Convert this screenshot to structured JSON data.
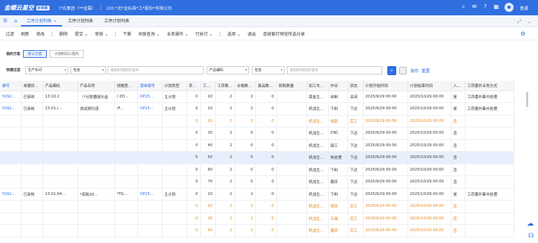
{
  "app": {
    "logo_text": "金蝶云星空",
    "badge": "标准版",
    "org": "（*氏集团（**金属）",
    "company": "100 *北*金标准*工*股份*有限公司",
    "user": "普通"
  },
  "tabs": [
    {
      "label": "工序计划列表",
      "active": true
    },
    {
      "label": "工序计划列表",
      "active": false
    },
    {
      "label": "工序计划列表",
      "active": false
    }
  ],
  "toolbar": [
    "过滤",
    "刷新",
    "修改",
    "删除",
    "提交",
    "审核",
    "下推",
    "关联查询",
    "业务操作",
    "行执行",
    "选项",
    "退出",
    "连续套打预览所选分录"
  ],
  "scheme": {
    "label": "我的方案",
    "buttons": [
      "默认方案",
      "计划时间三周内"
    ]
  },
  "filter": {
    "label": "快捷过滤",
    "field1": "生产车间",
    "op1": "包含",
    "placeholder1": "请选择内容回车查询",
    "field2": "产品编码",
    "op2": "包含",
    "placeholder2": "请选择内容回车查询",
    "save": "保存",
    "reset": "重置"
  },
  "columns": [
    "编号",
    "单据状...",
    "产品编码",
    "产品名称",
    "规格型...",
    "源单编号",
    "计划类型",
    "序...",
    "工...",
    "工序数...",
    "合格数...",
    "废品数...",
    "损耗数量",
    "加工车...",
    "作业",
    "状态",
    "计划开始时间",
    "计划结束时间",
    "入...",
    "工序委外业务方式"
  ],
  "rows": [
    {
      "style": "",
      "cells": [
        "5092...",
        "已审核",
        "13.10.2",
        "（*分割器接头盒",
        "/ ZD...",
        "OP25...",
        "主计划",
        "0",
        "10",
        "2",
        "2",
        "0",
        "",
        "钣金生...",
        "自制",
        "关闭",
        "2025/9/29 00:00",
        "2025/10/29 00:00",
        "是",
        "工序委外集中处理"
      ]
    },
    {
      "style": "",
      "cells": [
        "5092...",
        "已审核",
        "13.01.(...",
        "测试焊针座",
        "/F...",
        "OP25...",
        "主计划",
        "0",
        "10",
        "2",
        "2",
        "0",
        "",
        "机加生...",
        "下料",
        "下达",
        "2025/9/29 00:00",
        "2025/10/29 00:00",
        "是",
        "工序委外集中处理"
      ]
    },
    {
      "style": "orange",
      "cells": [
        "",
        "",
        "",
        "",
        "",
        "",
        "",
        "0",
        "20",
        "2",
        "0",
        "0",
        "",
        "机加生...",
        "线割",
        "完工",
        "2025/9/29 00:00",
        "2025/10/29 00:00",
        "否",
        ""
      ]
    },
    {
      "style": "",
      "cells": [
        "",
        "",
        "",
        "",
        "",
        "",
        "",
        "0",
        "30",
        "2",
        "0",
        "0",
        "",
        "机加生...",
        "CNC",
        "下达",
        "2025/9/29 00:00",
        "2025/10/29 00:00",
        "否",
        ""
      ]
    },
    {
      "style": "",
      "cells": [
        "",
        "",
        "",
        "",
        "",
        "",
        "",
        "0",
        "40",
        "2",
        "0",
        "0",
        "",
        "机加生...",
        "钳工",
        "下达",
        "2025/9/29 00:00",
        "2025/10/29 00:00",
        "否",
        ""
      ]
    },
    {
      "style": "sel",
      "cells": [
        "",
        "",
        "",
        "",
        "",
        "",
        "",
        "0",
        "50",
        "2",
        "0",
        "0",
        "",
        "机加生...",
        "热处理",
        "下达",
        "2025/9/29 00:00",
        "2025/10/29 00:00",
        "否",
        ""
      ]
    },
    {
      "style": "",
      "cells": [
        "",
        "",
        "",
        "",
        "",
        "",
        "",
        "0",
        "60",
        "2",
        "0",
        "0",
        "",
        "机加生...",
        "下料",
        "下达",
        "2025/9/29 00:00",
        "2025/10/29 00:00",
        "否",
        ""
      ]
    },
    {
      "style": "",
      "cells": [
        "",
        "",
        "",
        "",
        "",
        "",
        "",
        "0",
        "70",
        "2",
        "0",
        "0",
        "",
        "机加生...",
        "磨床",
        "下达",
        "2025/9/29 00:00",
        "2025/10/29 00:00",
        "否",
        ""
      ]
    },
    {
      "style": "",
      "cells": [
        "5092...",
        "已审核",
        "13.01.64...",
        "*底板30...",
        "*FG...",
        "OP25...",
        "主计划",
        "0",
        "10",
        "2",
        "2",
        "0",
        "",
        "机加生...",
        "下料",
        "下达",
        "2025/9/29 00:00",
        "2025/10/29 00:00",
        "是",
        "工序委外集中处理"
      ]
    },
    {
      "style": "orange",
      "cells": [
        "",
        "",
        "",
        "",
        "",
        "",
        "",
        "0",
        "20",
        "2",
        "2",
        "0",
        "",
        "机加生...",
        "铣床",
        "完工",
        "2025/9/29 00:00",
        "2025/10/29 00:00",
        "否",
        ""
      ]
    },
    {
      "style": "orange",
      "cells": [
        "",
        "",
        "",
        "",
        "",
        "",
        "",
        "0",
        "30",
        "2",
        "2",
        "0",
        "",
        "机加生...",
        "五轴",
        "完工",
        "2025/9/29 00:00",
        "2025/10/29 00:00",
        "否",
        ""
      ]
    },
    {
      "style": "orange",
      "cells": [
        "",
        "",
        "",
        "",
        "",
        "",
        "",
        "0",
        "40",
        "2",
        "2",
        "0",
        "",
        "机加生...",
        "磨床",
        "完工",
        "2025/9/29 00:00",
        "2025/10/29 00:00",
        "否",
        ""
      ]
    }
  ],
  "colors": {
    "brand": "#2f6fe0",
    "complete": "#e8820f",
    "selected_row": "#e8effc"
  }
}
